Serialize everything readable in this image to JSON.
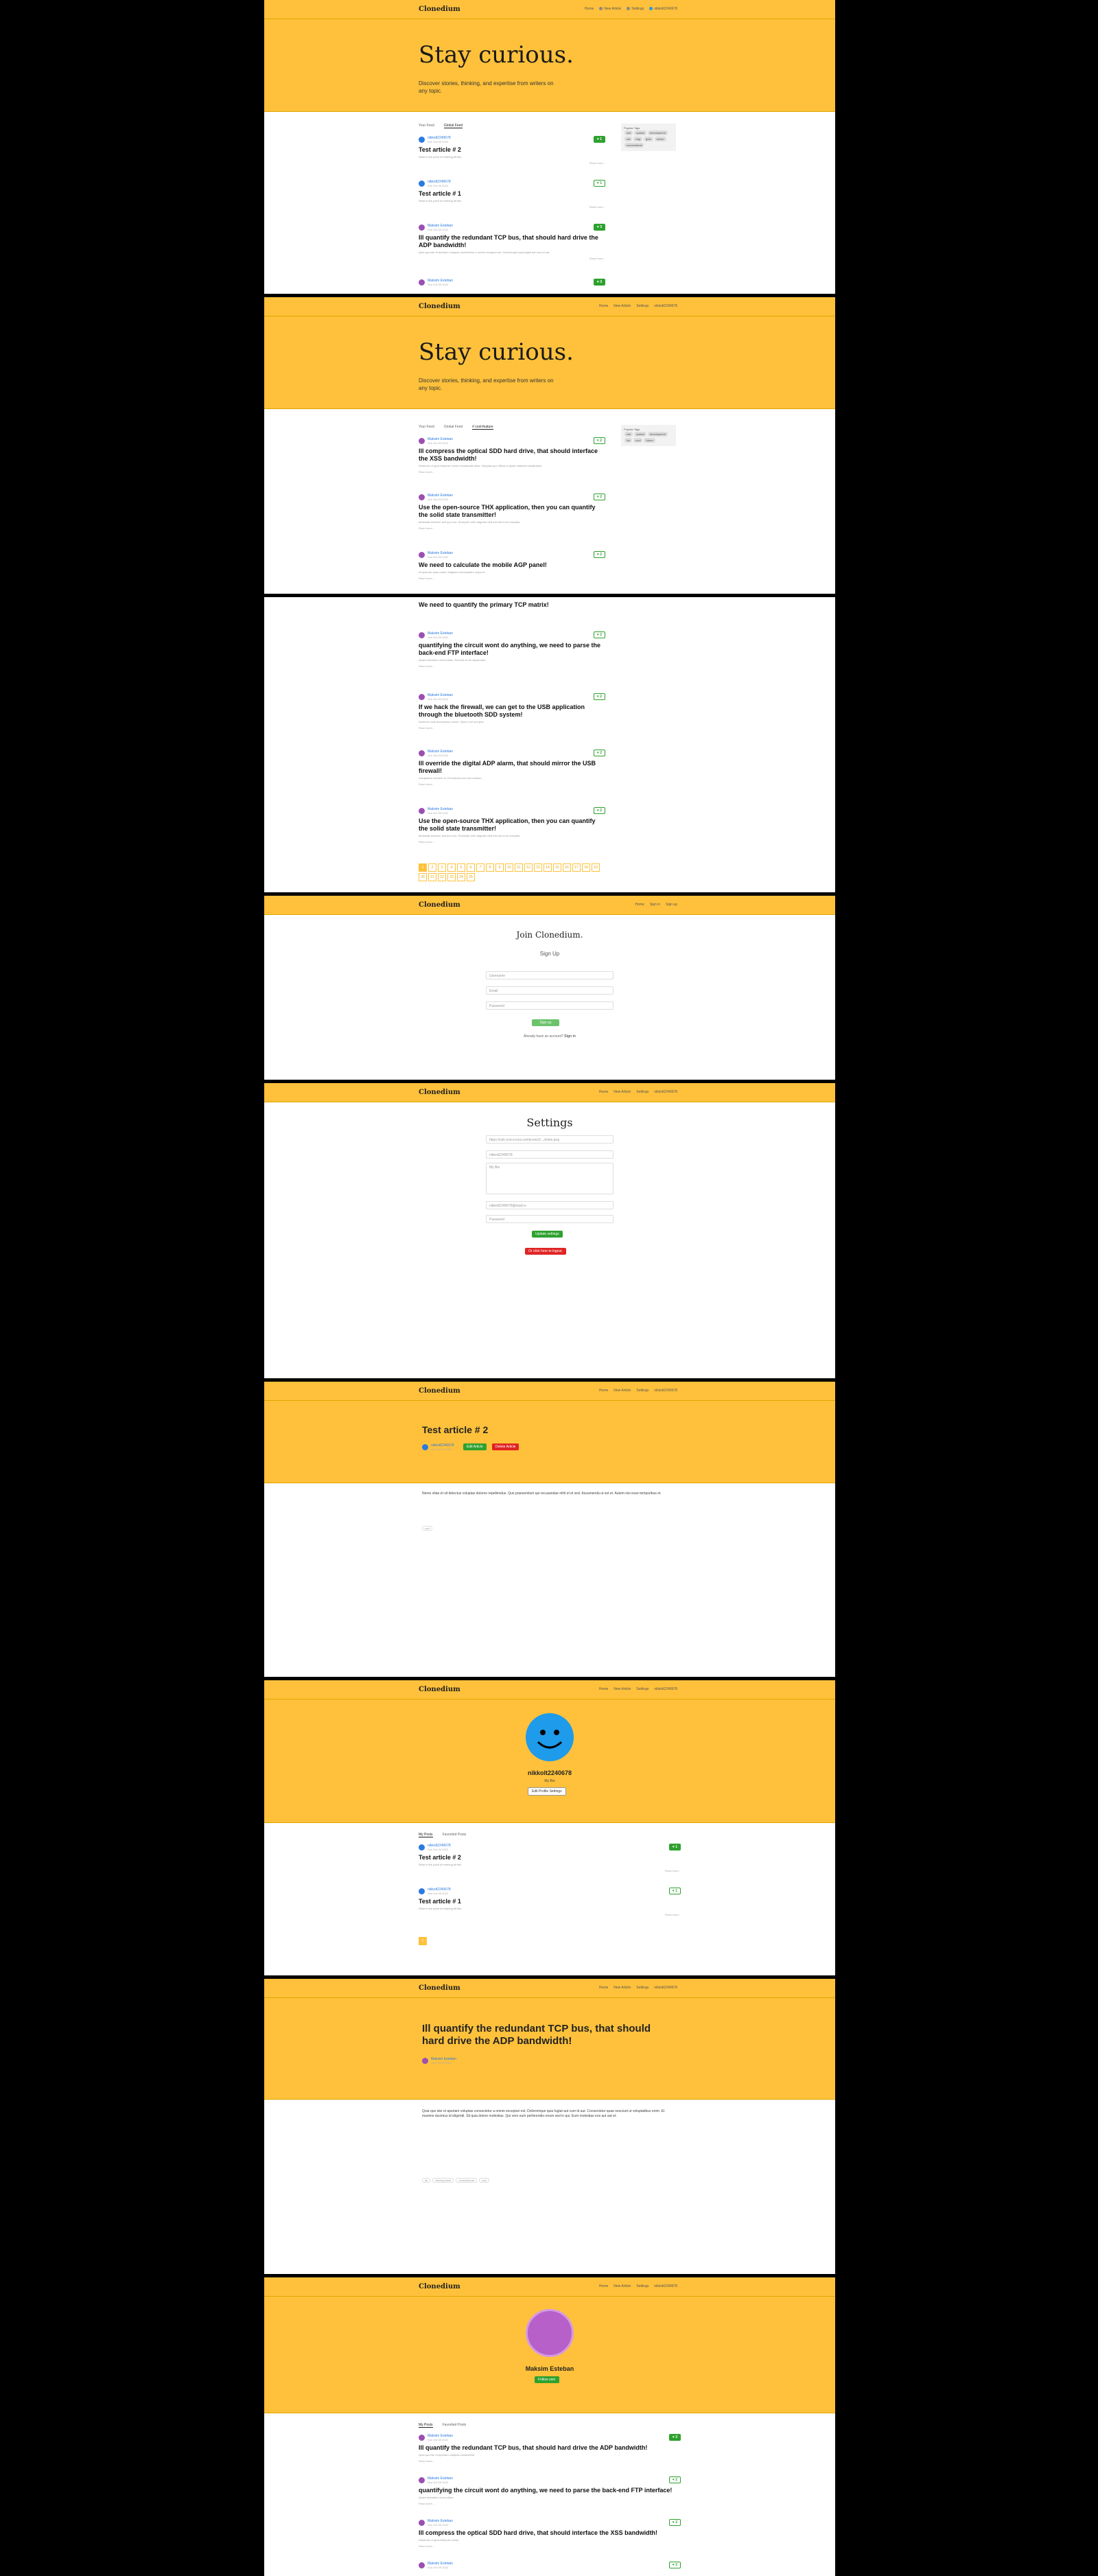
{
  "brand": "Clonedium",
  "nav": {
    "home": "Home",
    "new_article": "New Article",
    "settings": "Settings",
    "user": "nikkolt2240678",
    "signin": "Sign in",
    "signup": "Sign up"
  },
  "hero": {
    "title": "Stay curious.",
    "subtitle": "Discover stories, thinking, and expertise from writers on any topic."
  },
  "tabs": {
    "your_feed": "Your Feed",
    "global": "Global Feed",
    "tag": "# cool-feature"
  },
  "tags_title": "Popular Tags",
  "tags": [
    "sint",
    "quibus",
    "development",
    "cat",
    "dog",
    "guia",
    "monio",
    "conventional",
    "ios",
    "cool",
    "future",
    "chromium"
  ],
  "feed1": [
    {
      "author": "nikkolt2240678",
      "date": "Sun Oct 09 2022",
      "likes": "1",
      "title": "Test article # 2",
      "desc": "What is the point of entering all this",
      "tagline": "Read more..."
    },
    {
      "author": "nikkolt2240678",
      "date": "Sun Oct 09 2022",
      "likes": "1",
      "title": "Test article # 1",
      "desc": "What is the point of entering all this",
      "tagline": "Read more..."
    },
    {
      "author": "Maksim Esteban",
      "date": "Sun Oct 09 2022",
      "likes": "3",
      "title": "Ill quantify the redundant TCP bus, that should hard drive the ADP bandwidth!",
      "desc": "Quia quo iste et aperiam voluptas consectetur a omnis excepturi est. Doloremque quia fugiat aut cum id aut.",
      "tagline": "Read more..."
    },
    {
      "author": "Maksim Esteban",
      "date": "Sun Oct 09 2022",
      "likes": "3",
      "title": "",
      "desc": "",
      "tagline": ""
    }
  ],
  "feed2": [
    {
      "author": "Maksim Esteban",
      "date": "Sun Oct 09 2022",
      "likes": "2",
      "title": "Ill compress the optical SDD hard drive, that should interface the XSS bandwidth!",
      "desc": "Deserunt ut quos tempore minus recusandae alias. Voluptas quo officia ut ipsum delectus laudantium.",
      "tagline": "Read more..."
    },
    {
      "author": "Maksim Esteban",
      "date": "Sun Oct 09 2022",
      "likes": "2",
      "title": "Use the open-source THX application, then you can quantify the solid state transmitter!",
      "desc": "Molestias dolorem sed quo eos. Excepturi velit magnam nihil est sed id ea voluptas.",
      "tagline": "Read more..."
    },
    {
      "author": "Maksim Esteban",
      "date": "Sun Oct 09 2022",
      "likes": "2",
      "title": "We need to calculate the mobile AGP panel!",
      "desc": "Ut quia aut quas natus. Magnam consequatur culpa et.",
      "tagline": "Read more..."
    }
  ],
  "feed3": [
    {
      "author": "Maksim Esteban",
      "date": "Sun Oct 09 2022",
      "likes": "2",
      "title": "quantifying the circuit wont do anything, we need to parse the back-end FTP interface!",
      "desc": "Quam doloribus rerum ullam. Sed aut et vel aspernatur.",
      "tagline": "Read more..."
    },
    {
      "author": "Maksim Esteban",
      "date": "Sun Oct 09 2022",
      "likes": "2",
      "title": "If we hack the firewall, we can get to the USB application through the bluetooth SDD system!",
      "desc": "Nostrum modi accusamus dolore. Quos ut et aut quia.",
      "tagline": "Read more..."
    },
    {
      "author": "Maksim Esteban",
      "date": "Sun Oct 09 2022",
      "likes": "2",
      "title": "Ill override the digital ADP alarm, that should mirror the USB firewall!",
      "desc": "Voluptatem dolorem in. Est dolores eos est nostrum.",
      "tagline": "Read more..."
    },
    {
      "author": "Maksim Esteban",
      "date": "Sun Oct 09 2022",
      "likes": "2",
      "title": "Use the open-source THX application, then you can quantify the solid state transmitter!",
      "desc": "Molestias dolorem sed quo eos. Excepturi velit magnam nihil est sed id ea voluptas.",
      "tagline": "Read more..."
    }
  ],
  "feed3_top": "We need to quantify the primary TCP matrix!",
  "pages": [
    "1",
    "2",
    "3",
    "4",
    "5",
    "6",
    "7",
    "8",
    "9",
    "10",
    "11",
    "12",
    "13",
    "14",
    "15",
    "16",
    "17",
    "18",
    "19",
    "20",
    "21",
    "22",
    "23",
    "24",
    "25"
  ],
  "signup": {
    "title": "Join Clonedium.",
    "sub": "Sign Up",
    "username": "Username",
    "email": "Email",
    "password": "Password",
    "button": "Sign up",
    "have": "Already have an account?",
    "signin": "Sign in"
  },
  "settings": {
    "title": "Settings",
    "url": "https://cdn.icon-icons.com/icons2/.../smile.png",
    "username": "nikkolt2240678",
    "bio": "My Bio",
    "email": "nikkolt2240678@mail.ru",
    "password": "Password",
    "update": "Update settings",
    "logout": "Or click here to logout."
  },
  "article": {
    "title": "Test article # 2",
    "author": "nikkolt2240678",
    "date": "Sun Oct 09 2022",
    "edit": "Edit Article",
    "delete": "Delete Article",
    "body": "Nemo vitae et sit delectus voluptas dolores repellendus. Quo praesentium qui recusandae nihil et et sed. Assumenda ut est et. Autem nisi esse temporibus et.",
    "tag": "cool"
  },
  "profile": {
    "name": "nikkolt2240678",
    "bio": "My Bio",
    "edit": "Edit Profile Settings",
    "my_posts": "My Posts",
    "fav_posts": "Favorited Posts"
  },
  "article2": {
    "title": "Ill quantify the redundant TCP bus, that should hard drive the ADP bandwidth!",
    "author": "Maksim Esteban",
    "date": "Sun Oct 09 2022",
    "body": "Quia quo iste et aperiam voluptas consectetur a omnis excepturi est. Doloremque quia fugiat aut cum id aut. Consectetur quae nesciunt ut voluptatibus enim. Et maxime ducimus id eligendi. Sit quia dolore molestias. Qui vero eum perferendis rerum sed in qui. Eum molestias eos aut aut et.",
    "tags": [
      "ab",
      "development",
      "conventional",
      "cool"
    ]
  },
  "profile2": {
    "name": "Maksim Esteban",
    "follow": "Follow user",
    "my_posts": "My Posts",
    "fav_posts": "Favorited Posts"
  },
  "feed4": [
    {
      "author": "Maksim Esteban",
      "date": "Sun Oct 09 2022",
      "likes": "3",
      "title": "Ill quantify the redundant TCP bus, that should hard drive the ADP bandwidth!",
      "desc": "Quia quo iste et aperiam voluptas consectetur.",
      "tagline": "Read more..."
    },
    {
      "author": "Maksim Esteban",
      "date": "Sun Oct 09 2022",
      "likes": "2",
      "title": "quantifying the circuit wont do anything, we need to parse the back-end FTP interface!",
      "desc": "Quam doloribus rerum ullam.",
      "tagline": "Read more..."
    },
    {
      "author": "Maksim Esteban",
      "date": "Sun Oct 09 2022",
      "likes": "2",
      "title": "Ill compress the optical SDD hard drive, that should interface the XSS bandwidth!",
      "desc": "Deserunt ut quos tempore minus.",
      "tagline": "Read more..."
    },
    {
      "author": "Maksim Esteban",
      "date": "Sun Oct 09 2022",
      "likes": "2",
      "title": "",
      "desc": "",
      "tagline": ""
    }
  ]
}
